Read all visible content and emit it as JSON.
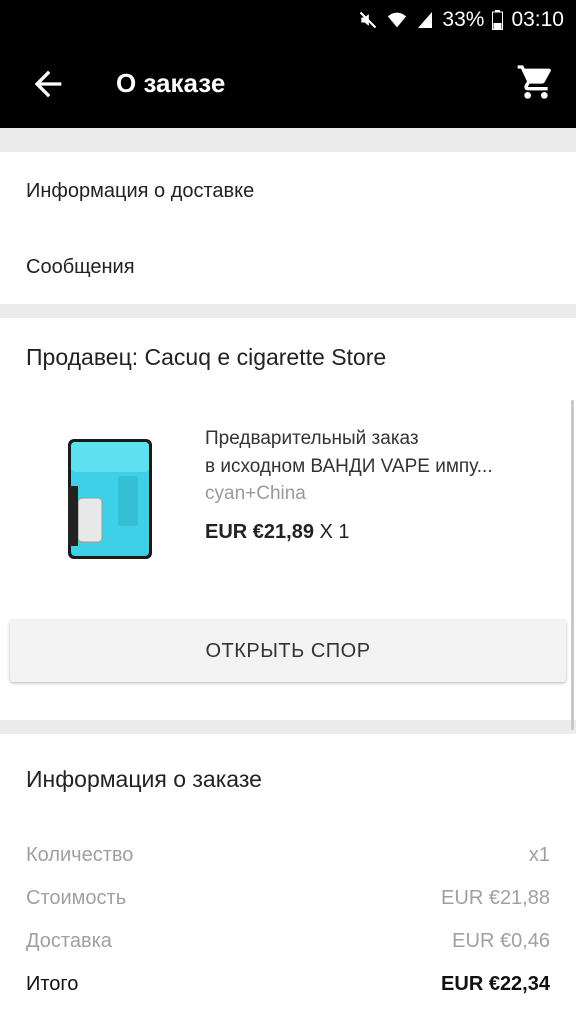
{
  "status_bar": {
    "battery": "33%",
    "time": "03:10"
  },
  "app_bar": {
    "title": "О заказе"
  },
  "links": {
    "delivery_info": "Информация о доставке",
    "messages": "Сообщения"
  },
  "seller": {
    "label": "Продавец: Cacuq e cigarette Store"
  },
  "product": {
    "title_line1": "Предварительный заказ",
    "title_line2": "в исходном ВАНДИ VAPE импу...",
    "variant": "cyan+China",
    "price": "EUR €21,89",
    "quantity": "X 1"
  },
  "dispute_button": "ОТКРЫТЬ СПОР",
  "order_info": {
    "title": "Информация о заказе",
    "rows": [
      {
        "label": "Количество",
        "value": "x1"
      },
      {
        "label": "Стоимость",
        "value": "EUR €21,88"
      },
      {
        "label": "Доставка",
        "value": "EUR €0,46"
      }
    ],
    "total": {
      "label": "Итого",
      "value": "EUR €22,34"
    }
  },
  "colors": {
    "app_bar": "#000000",
    "product_accent": "#3ed0e6"
  }
}
